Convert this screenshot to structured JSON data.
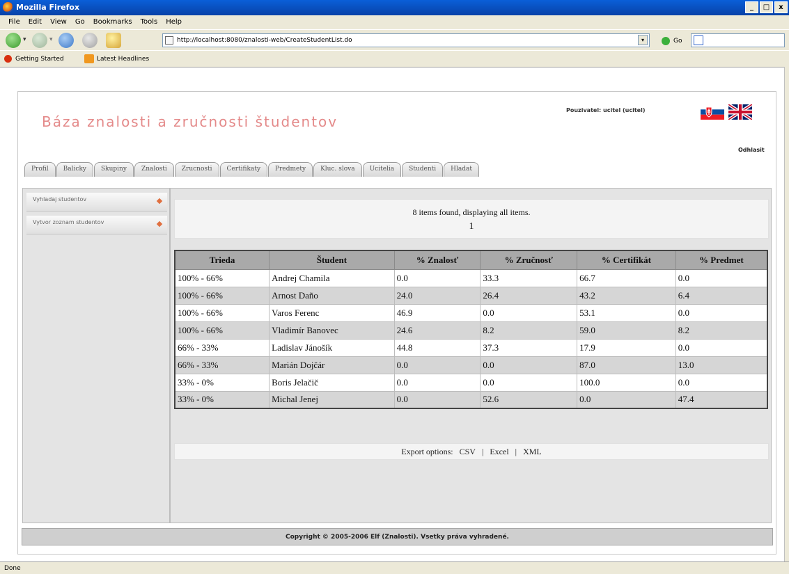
{
  "window": {
    "title": "Mozilla Firefox",
    "controls": [
      "_",
      "□",
      "x"
    ]
  },
  "menu": [
    "File",
    "Edit",
    "View",
    "Go",
    "Bookmarks",
    "Tools",
    "Help"
  ],
  "nav": {
    "url": "http://localhost:8080/znalosti-web/CreateStudentList.do",
    "go_label": "Go"
  },
  "bookmarks": [
    "Getting Started",
    "Latest Headlines"
  ],
  "page": {
    "site_title": "Báza znalosti a zručnosti študentov",
    "user_label": "Pouzivatel: ucitel (ucitel)",
    "logout": "Odhlasit",
    "tabs": [
      "Profil",
      "Balicky",
      "Skupiny",
      "Znalosti",
      "Zrucnosti",
      "Certifikaty",
      "Predmety",
      "Kluc. slova",
      "Ucitelia",
      "Studenti",
      "Hladat"
    ],
    "sidebar": [
      "Vyhladaj studentov",
      "Vytvor zoznam studentov"
    ],
    "pager": {
      "found": "8 items found, displaying all items.",
      "page": "1"
    },
    "table": {
      "headers": [
        "Trieda",
        "Študent",
        "% Znalosť",
        "% Zručnosť",
        "% Certifikát",
        "% Predmet"
      ],
      "rows": [
        [
          "100% - 66%",
          "Andrej Chamila",
          "0.0",
          "33.3",
          "66.7",
          "0.0"
        ],
        [
          "100% - 66%",
          "Arnost Daño",
          "24.0",
          "26.4",
          "43.2",
          "6.4"
        ],
        [
          "100% - 66%",
          "Varos Ferenc",
          "46.9",
          "0.0",
          "53.1",
          "0.0"
        ],
        [
          "100% - 66%",
          "Vladimír Banovec",
          "24.6",
          "8.2",
          "59.0",
          "8.2"
        ],
        [
          "66% - 33%",
          "Ladislav Jánošík",
          "44.8",
          "37.3",
          "17.9",
          "0.0"
        ],
        [
          "66% - 33%",
          "Marián Dojčár",
          "0.0",
          "0.0",
          "87.0",
          "13.0"
        ],
        [
          "33% - 0%",
          "Boris Jelačič",
          "0.0",
          "0.0",
          "100.0",
          "0.0"
        ],
        [
          "33% - 0%",
          "Michal Jenej",
          "0.0",
          "52.6",
          "0.0",
          "47.4"
        ]
      ]
    },
    "export": {
      "label": "Export options:",
      "csv": "CSV",
      "excel": "Excel",
      "xml": "XML",
      "sep": "|"
    },
    "footer": "Copyright © 2005-2006 Elf (Znalosti). Vsetky práva vyhradené."
  },
  "status": "Done"
}
